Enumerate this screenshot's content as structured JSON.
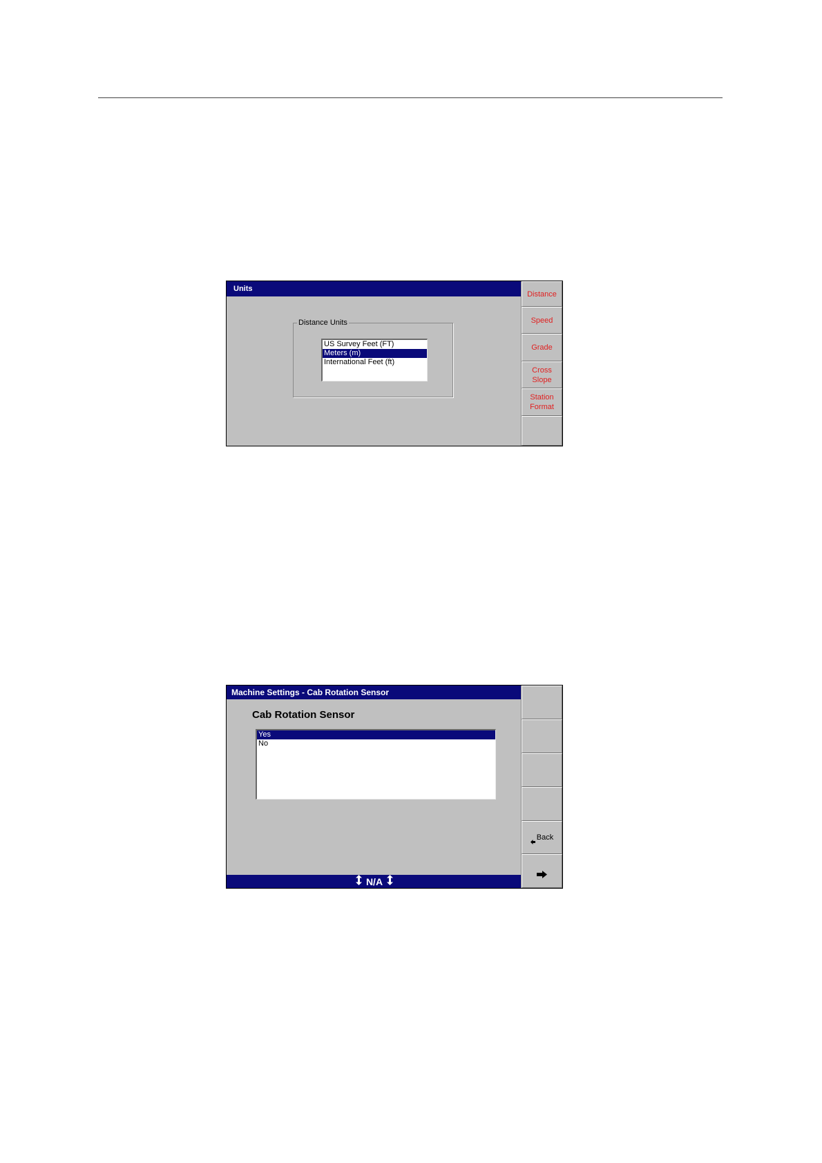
{
  "screens": {
    "units": {
      "title": "Units",
      "group_label": "Distance Units",
      "options": [
        {
          "label": "US Survey Feet (FT)",
          "selected": false
        },
        {
          "label": "Meters (m)",
          "selected": true
        },
        {
          "label": "International Feet (ft)",
          "selected": false
        }
      ],
      "softkeys": [
        "Distance",
        "Speed",
        "Grade",
        "Cross\nSlope",
        "Station\nFormat",
        ""
      ],
      "softkey_color": "#e02020"
    },
    "cab_rotation": {
      "title": "Machine Settings - Cab Rotation Sensor",
      "heading": "Cab Rotation Sensor",
      "options": [
        {
          "label": "Yes",
          "selected": true
        },
        {
          "label": "No",
          "selected": false
        }
      ],
      "status": "N/A",
      "status_icon": "up-down-arrow-icon",
      "softkeys": [
        "",
        "",
        "",
        "",
        "Back",
        ""
      ],
      "back_icon": "left-arrow-icon",
      "next_icon": "right-arrow-icon"
    }
  },
  "colors": {
    "titlebar": "#0a0a7a",
    "panel": "#c0c0c0",
    "selection": "#0a0a7a"
  }
}
